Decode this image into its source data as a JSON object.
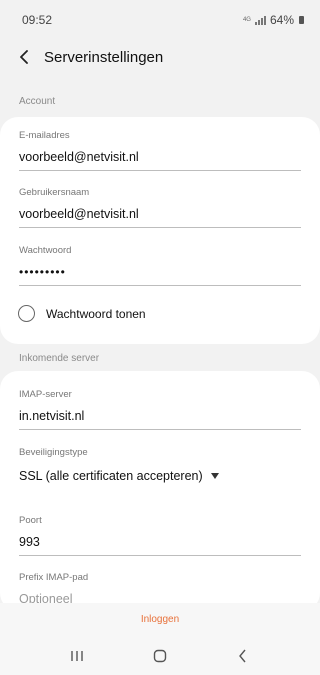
{
  "status_bar": {
    "time": "09:52",
    "network": "4G",
    "battery": "64%"
  },
  "header": {
    "title": "Serverinstellingen",
    "back_icon": "chevron-left-icon"
  },
  "account": {
    "section_title": "Account",
    "email_label": "E-mailadres",
    "email_value": "voorbeeld@netvisit.nl",
    "username_label": "Gebruikersnaam",
    "username_value": "voorbeeld@netvisit.nl",
    "password_label": "Wachtwoord",
    "password_value": "•••••••••",
    "show_password_label": "Wachtwoord tonen"
  },
  "incoming": {
    "section_title": "Inkomende server",
    "imap_label": "IMAP-server",
    "imap_value": "in.netvisit.nl",
    "security_label": "Beveiligingstype",
    "security_value": "SSL (alle certificaten accepteren)",
    "port_label": "Poort",
    "port_value": "993",
    "prefix_label": "Prefix IMAP-pad",
    "prefix_placeholder": "Optioneel"
  },
  "actions": {
    "login_label": "Inloggen"
  },
  "colors": {
    "accent": "#e8713a",
    "background": "#f2f2f2",
    "card": "#ffffff"
  }
}
